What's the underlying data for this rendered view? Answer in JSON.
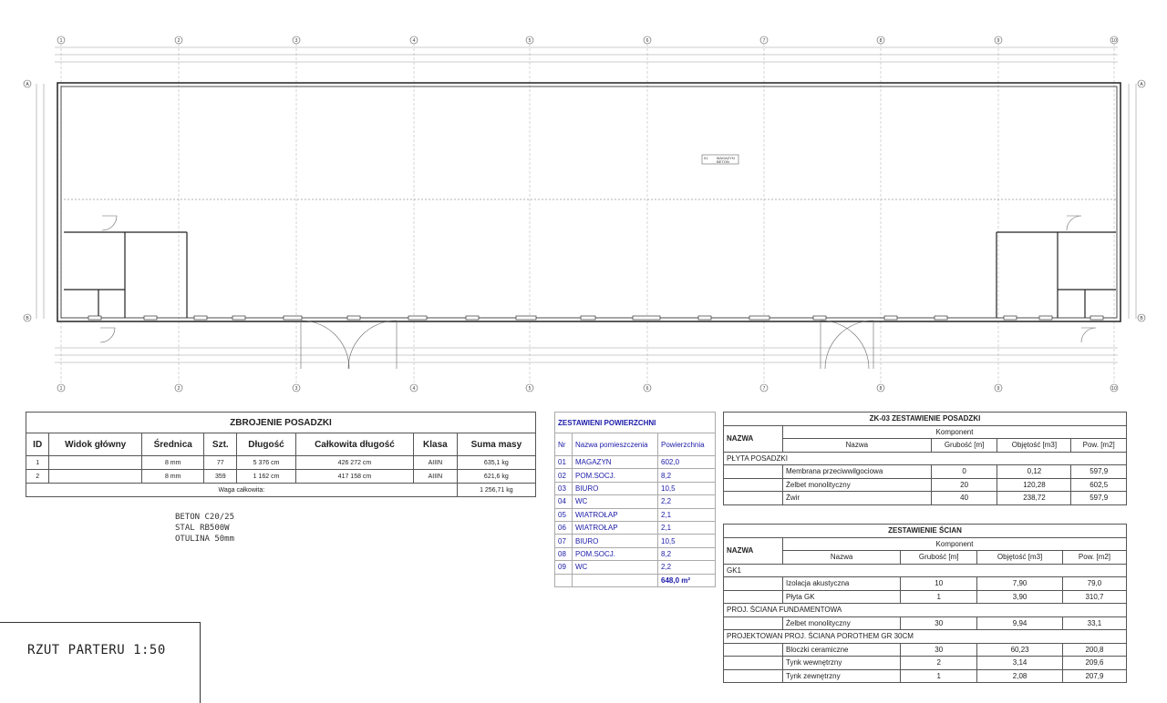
{
  "zbrojenie": {
    "title": "ZBROJENIE POSADZKI",
    "headers": [
      "ID",
      "Widok główny",
      "Średnica",
      "Szt.",
      "Długość",
      "Całkowita długość",
      "Klasa",
      "Suma masy"
    ],
    "rows": [
      [
        "1",
        "",
        "8 mm",
        "77",
        "5 376 cm",
        "426 272 cm",
        "AIIIN",
        "635,1 kg"
      ],
      [
        "2",
        "",
        "8 mm",
        "359",
        "1 162 cm",
        "417 158 cm",
        "AIIIN",
        "621,6 kg"
      ]
    ],
    "total_label": "Waga całkowita:",
    "total_value": "1 256,71 kg"
  },
  "notes": [
    "BETON C20/25",
    "STAL RB500W",
    "OTULINA 50mm"
  ],
  "powierzchnie": {
    "title": "ZESTAWIENI POWIERZCHNI",
    "headers": [
      "Nr",
      "Nazwa pomieszczenia",
      "Powierzchnia"
    ],
    "rows": [
      [
        "01",
        "MAGAZYN",
        "602,0"
      ],
      [
        "02",
        "POM.SOCJ.",
        "8,2"
      ],
      [
        "03",
        "BIURO",
        "10,5"
      ],
      [
        "04",
        "WC",
        "2,2"
      ],
      [
        "05",
        "WIATROŁAP",
        "2,1"
      ],
      [
        "06",
        "WIATROŁAP",
        "2,1"
      ],
      [
        "07",
        "BIURO",
        "10,5"
      ],
      [
        "08",
        "POM.SOCJ.",
        "8,2"
      ],
      [
        "09",
        "WC",
        "2,2"
      ]
    ],
    "total": "648,0 m²"
  },
  "posadzka": {
    "title": "ZK-03 ZESTAWIENIE POSADZKI",
    "nazwa_label": "NAZWA",
    "komponent_label": "Komponent",
    "sub_headers": [
      "Nazwa",
      "Grubość [m]",
      "Objętość [m3]",
      "Pow. [m2]"
    ],
    "group": "PŁYTA POSADZKI",
    "rows": [
      [
        "Membrana przeciwwilgociowa",
        "0",
        "0,12",
        "597,9"
      ],
      [
        "Żelbet monolityczny",
        "20",
        "120,28",
        "602,5"
      ],
      [
        "Żwir",
        "40",
        "238,72",
        "597,9"
      ]
    ]
  },
  "sciany": {
    "title": "ZESTAWIENIE ŚCIAN",
    "nazwa_label": "NAZWA",
    "komponent_label": "Komponent",
    "sub_headers": [
      "Nazwa",
      "Grubość [m]",
      "Objętość [m3]",
      "Pow. [m2]"
    ],
    "groups": [
      {
        "name": "GK1",
        "rows": [
          [
            "Izolacja akustyczna",
            "10",
            "7,90",
            "79,0"
          ],
          [
            "Płyta GK",
            "1",
            "3,90",
            "310,7"
          ]
        ]
      },
      {
        "name": "PROJ. ŚCIANA FUNDAMENTOWA",
        "rows": [
          [
            "Żelbet monolityczny",
            "30",
            "9,94",
            "33,1"
          ]
        ]
      },
      {
        "name": "PROJEKTOWAN PROJ. ŚCIANA POROTHEM GR 30CM",
        "rows": [
          [
            "Bloczki ceramiczne",
            "30",
            "60,23",
            "200,8"
          ],
          [
            "Tynk wewnętrzny",
            "2",
            "3,14",
            "209,6"
          ],
          [
            "Tynk zewnętrzny",
            "1",
            "2,08",
            "207,9"
          ]
        ]
      }
    ]
  },
  "plan": {
    "grid_numbers": [
      "1",
      "2",
      "3",
      "4",
      "5",
      "6",
      "7",
      "8",
      "9",
      "10"
    ],
    "grid_letters": [
      "A",
      "B"
    ],
    "room_label": "MAGAZYN",
    "room_sub": "BETON"
  },
  "drawing_title": "RZUT PARTERU 1:50"
}
